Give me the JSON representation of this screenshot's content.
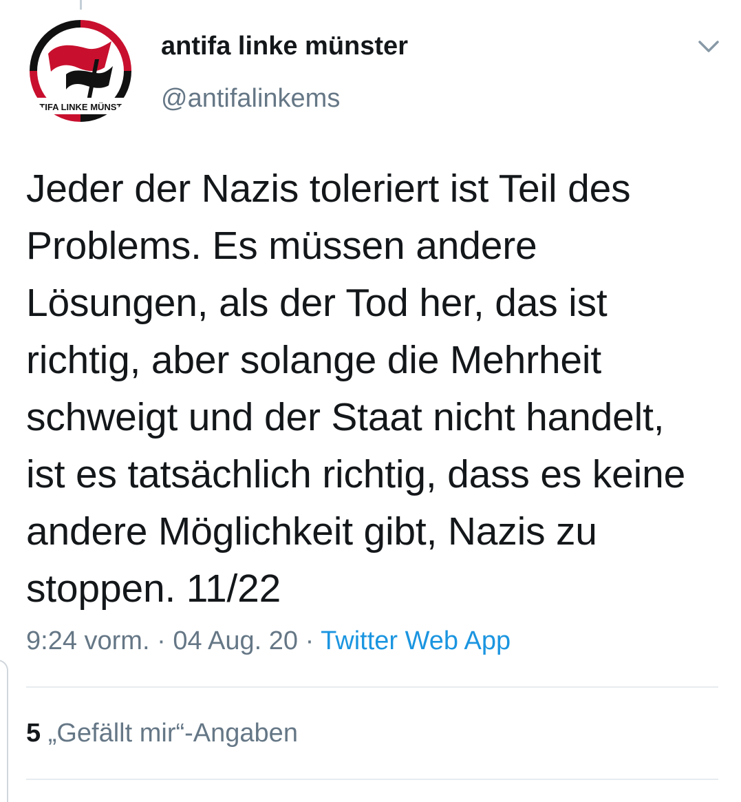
{
  "tweet": {
    "display_name": "antifa linke münster",
    "handle": "@antifalinkems",
    "avatar": {
      "icon": "antifa-flag-logo",
      "logo_text": "ANTIFA LINKE MÜNSTER",
      "colors": {
        "red": "#c8102e",
        "black": "#111111"
      }
    },
    "text": "Jeder der Nazis toleriert ist Teil des Problems. Es müssen andere Lösungen, als der Tod her, das ist richtig, aber solange die Mehrheit schweigt und der Staat nicht handelt,  ist es tatsächlich richtig, dass es keine andere Möglichkeit gibt, Nazis zu stoppen. 11/22",
    "time": "9:24 vorm.",
    "separator": "·",
    "date": "04 Aug. 20",
    "source": "Twitter Web App",
    "likes_count": "5",
    "likes_label": "„Gefällt mir“-Angaben",
    "menu_icon": "chevron-down-icon"
  },
  "colors": {
    "text": "#14171a",
    "secondary": "#657786",
    "link": "#1b95e0",
    "divider": "#e6ecf0"
  }
}
